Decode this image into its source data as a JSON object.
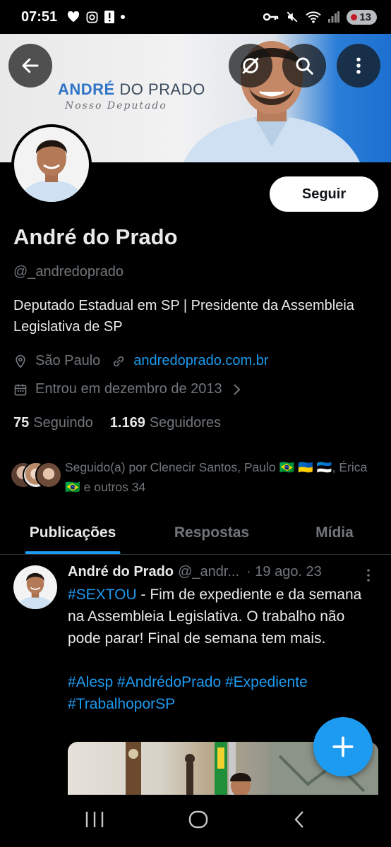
{
  "status_bar": {
    "time": "07:51",
    "battery": "13"
  },
  "banner": {
    "name_first": "ANDRÉ",
    "name_rest": " DO PRADO",
    "subtitle": "Nosso Deputado"
  },
  "profile": {
    "follow_label": "Seguir",
    "name": "André do Prado",
    "handle": "@_andredoprado",
    "bio": "Deputado Estadual em SP  | Presidente da Assembleia Legislativa de SP",
    "location": "São Paulo",
    "website": "andredoprado.com.br",
    "joined": "Entrou em dezembro de 2013",
    "following_count": "75",
    "following_label": "Seguindo",
    "followers_count": "1.169",
    "followers_label": "Seguidores",
    "followed_by": "Seguido(a) por Clenecir Santos, Paulo 🇧🇷 🇺🇦 🇪🇪, Érica 🇧🇷 e outros 34"
  },
  "tabs": [
    {
      "label": "Publicações",
      "active": true
    },
    {
      "label": "Respostas",
      "active": false
    },
    {
      "label": "Mídia",
      "active": false
    }
  ],
  "tweet": {
    "name": "André do Prado",
    "handle": "@_andr...",
    "date": "· 19 ago. 23",
    "hashtag_lead": "#SEXTOU",
    "text": " - Fim de expediente e da semana na Assembleia Legislativa. O trabalho não pode parar! Final de semana tem mais.",
    "hashtags_line1": "#Alesp #AndrédoPrado #Expediente",
    "hashtags_line2": "#TrabalhoporSP"
  },
  "colors": {
    "accent": "#1d9bf0",
    "background": "#000000",
    "muted": "#71767b"
  },
  "icons": [
    "back-arrow-icon",
    "no-notifications-icon",
    "search-icon",
    "more-vertical-icon",
    "location-pin-icon",
    "link-icon",
    "calendar-icon",
    "chevron-right-icon",
    "plus-icon",
    "recent-apps-icon",
    "home-icon",
    "back-icon"
  ]
}
